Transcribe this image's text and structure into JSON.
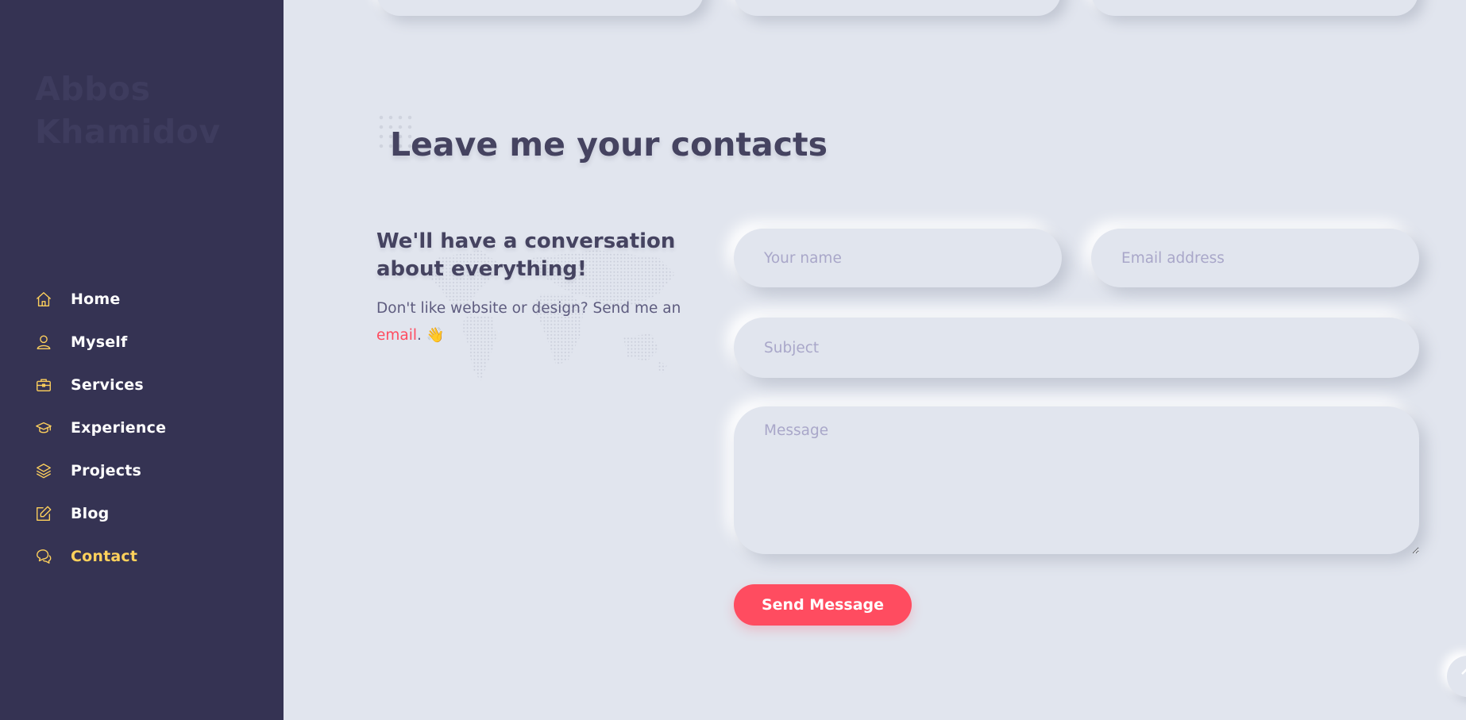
{
  "brand": {
    "line1": "Abbos",
    "line2": "Khamidov"
  },
  "nav": {
    "items": [
      {
        "label": "Home",
        "icon": "home-icon",
        "active": false
      },
      {
        "label": "Myself",
        "icon": "user-icon",
        "active": false
      },
      {
        "label": "Services",
        "icon": "briefcase-icon",
        "active": false
      },
      {
        "label": "Experience",
        "icon": "graduation-cap-icon",
        "active": false
      },
      {
        "label": "Projects",
        "icon": "layers-icon",
        "active": false
      },
      {
        "label": "Blog",
        "icon": "edit-icon",
        "active": false
      },
      {
        "label": "Contact",
        "icon": "chat-icon",
        "active": true
      }
    ]
  },
  "section": {
    "title": "Leave me your contacts"
  },
  "intro": {
    "heading": "We'll have a conversation about everything!",
    "text_before": "Don't like website or design? Send me an ",
    "link": "email",
    "text_after": ". 👋"
  },
  "form": {
    "name_placeholder": "Your name",
    "email_placeholder": "Email address",
    "subject_placeholder": "Subject",
    "message_placeholder": "Message",
    "submit_label": "Send Message"
  },
  "colors": {
    "sidebar_bg": "#353353",
    "page_bg": "#e1e5ee",
    "accent_yellow": "#ffd15c",
    "accent_red": "#ff4c60",
    "heading": "#454360"
  }
}
